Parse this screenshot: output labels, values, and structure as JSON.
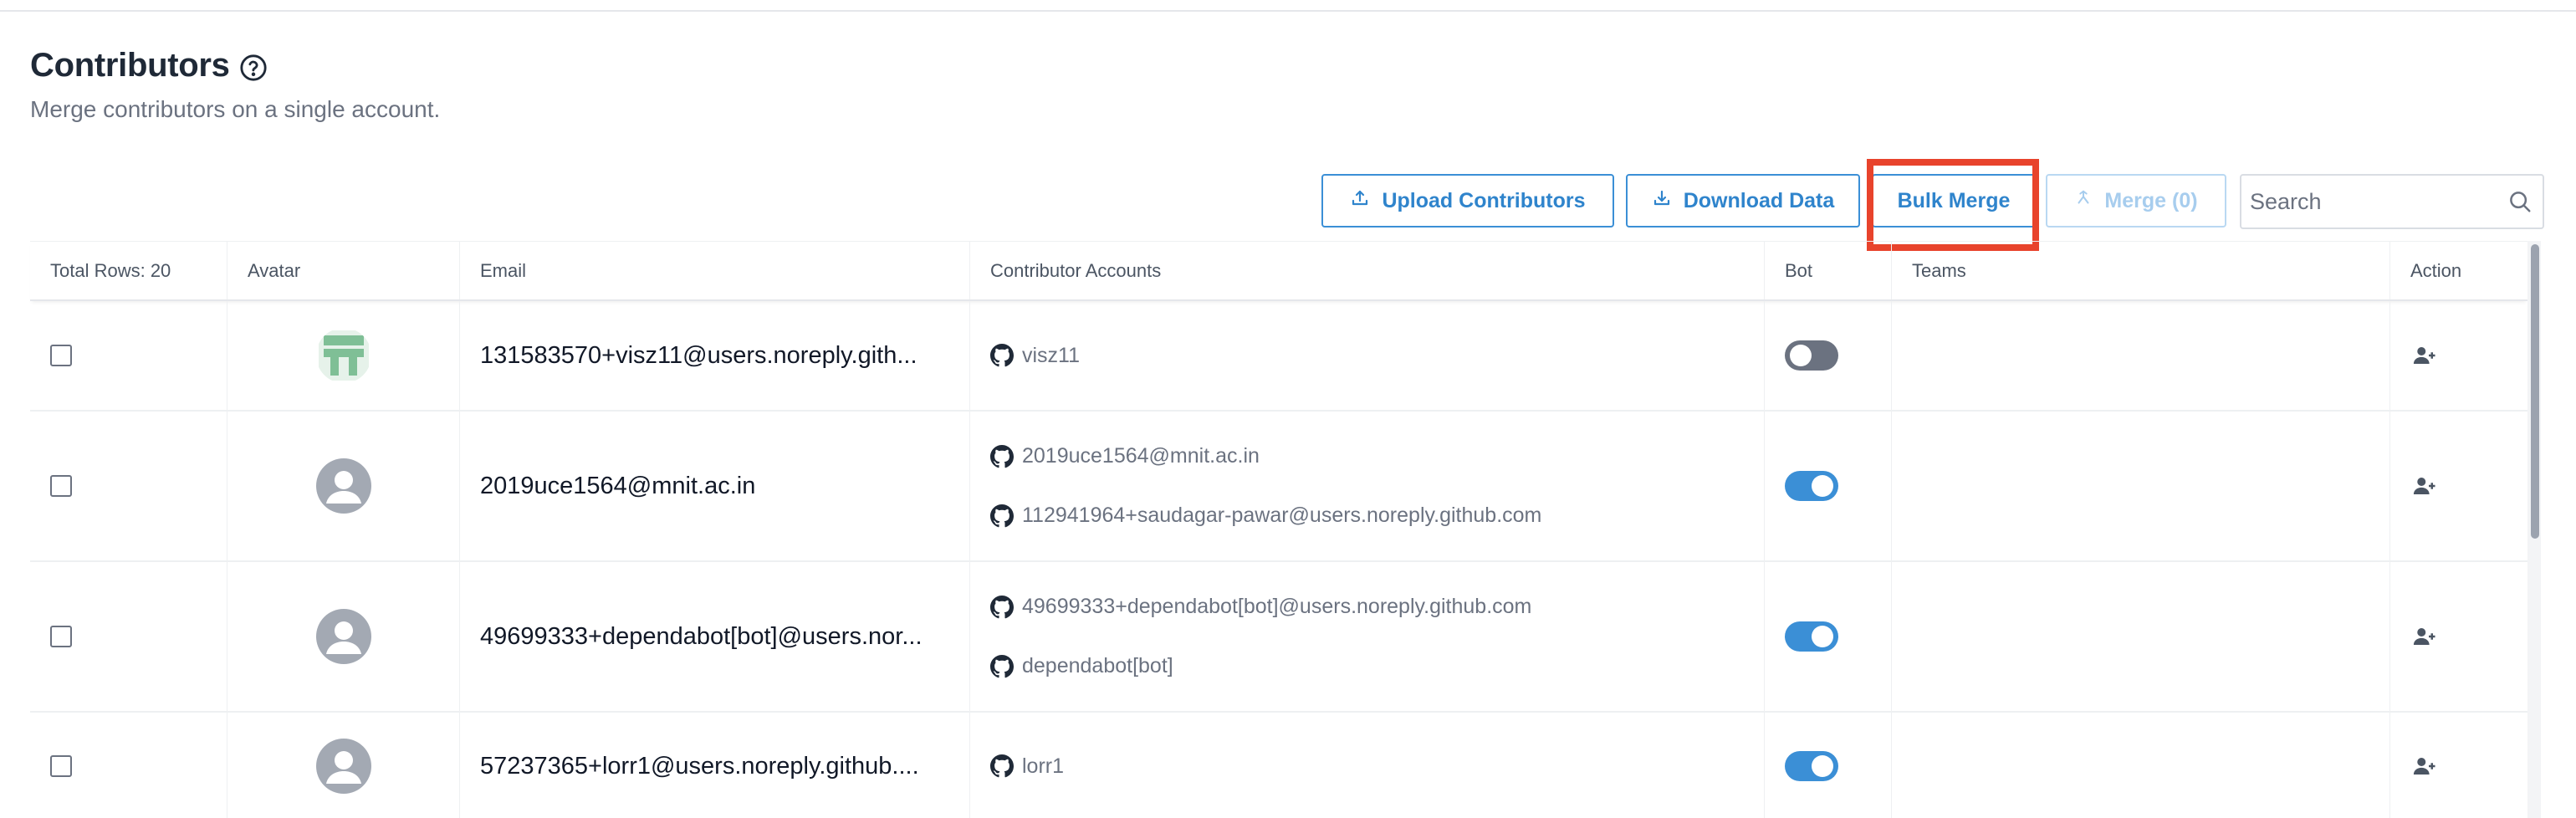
{
  "header": {
    "title": "Contributors",
    "subtitle": "Merge contributors on a single account."
  },
  "toolbar": {
    "upload_label": "Upload Contributors",
    "download_label": "Download Data",
    "bulk_merge_label": "Bulk Merge",
    "merge_label": "Merge (0)",
    "search_placeholder": "Search",
    "accent_color": "#3b8fd6",
    "highlight_color": "#e8432c"
  },
  "table": {
    "columns": {
      "select": "Total Rows: 20",
      "avatar": "Avatar",
      "email": "Email",
      "accounts": "Contributor Accounts",
      "bot": "Bot",
      "teams": "Teams",
      "action": "Action"
    },
    "rows": [
      {
        "email": "131583570+visz11@users.noreply.gith...",
        "avatar": "identicon",
        "accounts": [
          "visz11"
        ],
        "bot": false,
        "teams": ""
      },
      {
        "email": "2019uce1564@mnit.ac.in",
        "avatar": "default-user",
        "accounts": [
          "2019uce1564@mnit.ac.in",
          "112941964+saudagar-pawar@users.noreply.github.com"
        ],
        "bot": true,
        "teams": ""
      },
      {
        "email": "49699333+dependabot[bot]@users.nor...",
        "avatar": "default-user",
        "accounts": [
          "49699333+dependabot[bot]@users.noreply.github.com",
          "dependabot[bot]"
        ],
        "bot": true,
        "teams": ""
      },
      {
        "email": "57237365+lorr1@users.noreply.github....",
        "avatar": "default-user",
        "accounts": [
          "lorr1"
        ],
        "bot": true,
        "teams": ""
      }
    ]
  }
}
